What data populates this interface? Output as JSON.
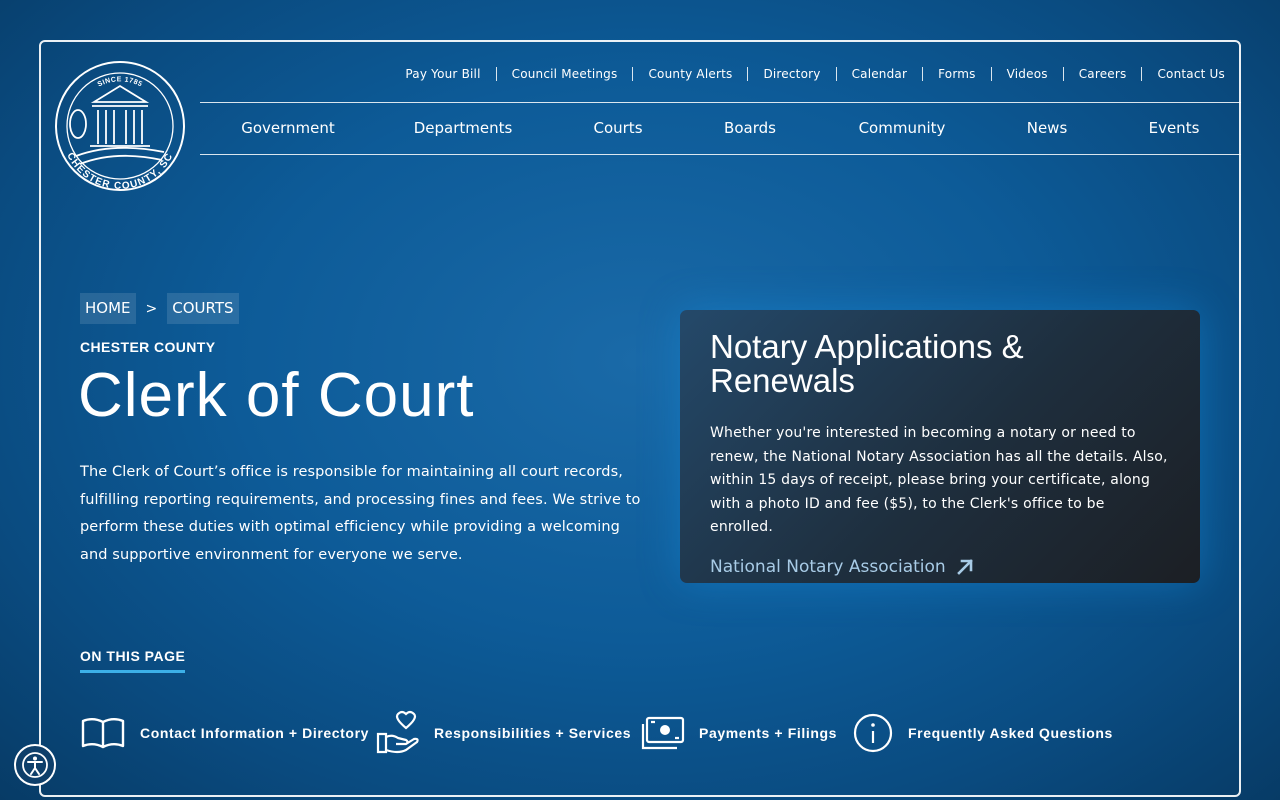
{
  "seal": {
    "top_text": "SINCE 1785",
    "bottom_text": "CHESTER COUNTY, SC"
  },
  "utility_nav": [
    "Pay Your Bill",
    "Council Meetings",
    "County Alerts",
    "Directory",
    "Calendar",
    "Forms",
    "Videos",
    "Careers",
    "Contact Us"
  ],
  "main_nav": [
    "Government",
    "Departments",
    "Courts",
    "Boards",
    "Community",
    "News",
    "Events"
  ],
  "breadcrumb": {
    "home": "HOME",
    "separator": ">",
    "current": "COURTS"
  },
  "eyebrow": "CHESTER COUNTY",
  "title": "Clerk of Court",
  "intro": "The Clerk of Court’s office is responsible for maintaining all court records, fulfilling reporting requirements, and processing fines and fees. We strive to perform these duties with optimal efficiency while providing a welcoming and supportive environment for everyone we serve.",
  "card": {
    "title": "Notary Applications & Renewals",
    "body": "Whether you're interested in becoming a notary or need to renew, the National Notary Association has all the details. Also, within 15 days of receipt, please bring your certificate, along with a photo ID and fee ($5), to the Clerk's office to be enrolled.",
    "link_label": "National Notary Association"
  },
  "on_this_page": {
    "heading": "ON THIS PAGE",
    "items": [
      {
        "label": "Contact Information + Directory",
        "icon": "open-book-icon"
      },
      {
        "label": "Responsibilities + Services",
        "icon": "heart-hand-icon"
      },
      {
        "label": "Payments + Filings",
        "icon": "cash-icon"
      },
      {
        "label": "Frequently Asked Questions",
        "icon": "info-icon"
      }
    ]
  },
  "colors": {
    "accent_underline": "#3cb0e8",
    "link": "#a8cbe6",
    "background": "#0d5b98"
  }
}
